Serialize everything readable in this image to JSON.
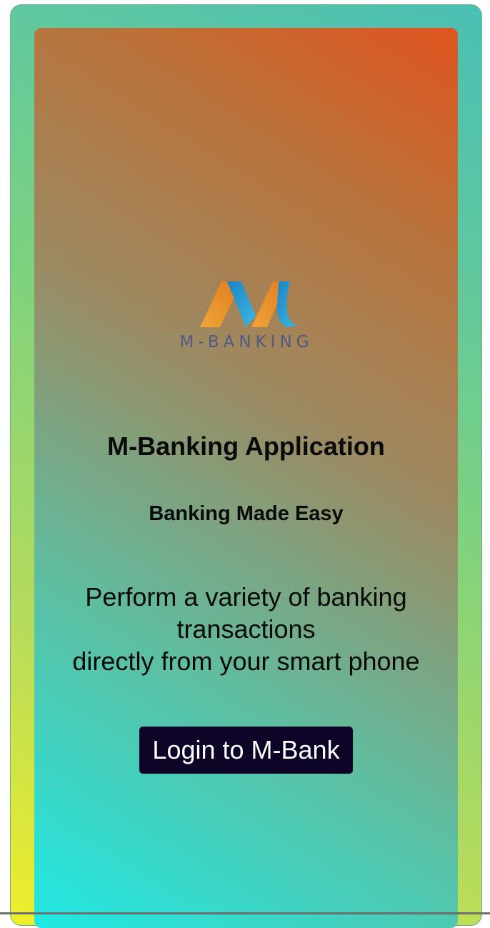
{
  "brand": {
    "wordmark": "M-BANKING",
    "icon": "m-letter-logo-icon"
  },
  "hero": {
    "title": "M-Banking Application",
    "tagline": "Banking Made Easy",
    "description_line1": "Perform a variety of banking",
    "description_line2": "transactions",
    "description_line3": "directly from your smart phone"
  },
  "actions": {
    "login_label": "Login to M-Bank"
  },
  "colors": {
    "button_bg": "#0d0427",
    "button_text": "#ffffff",
    "wordmark": "#505a86",
    "panel_top_right": "#e0541e",
    "panel_bottom_left": "#1fe9e4",
    "frame_left": "#f0ee2a",
    "frame_right": "#4bbfb5"
  }
}
